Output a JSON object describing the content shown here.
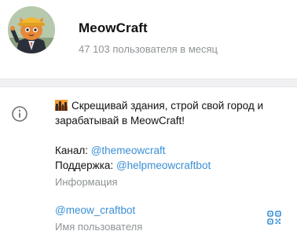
{
  "profile": {
    "name": "MeowCraft",
    "subscribers": "47 103 пользователя в месяц",
    "avatar_icon": "cat-builder-avatar"
  },
  "info": {
    "icon": "info-icon",
    "description_line1": "Скрещивай здания, строй свой город и",
    "description_line2": "зарабатывай в MeowCraft!",
    "channel_label": "Канал: ",
    "channel_link": "@themeowcraft",
    "support_label": "Поддержка: ",
    "support_link": "@helpmeowcraftbot",
    "caption": "Информация"
  },
  "username": {
    "value": "@meow_craftbot",
    "caption": "Имя пользователя",
    "qr_icon": "qr-code-icon"
  },
  "colors": {
    "link": "#3a8fd6",
    "caption": "#8e9396",
    "separator": "#f1f1f4"
  }
}
